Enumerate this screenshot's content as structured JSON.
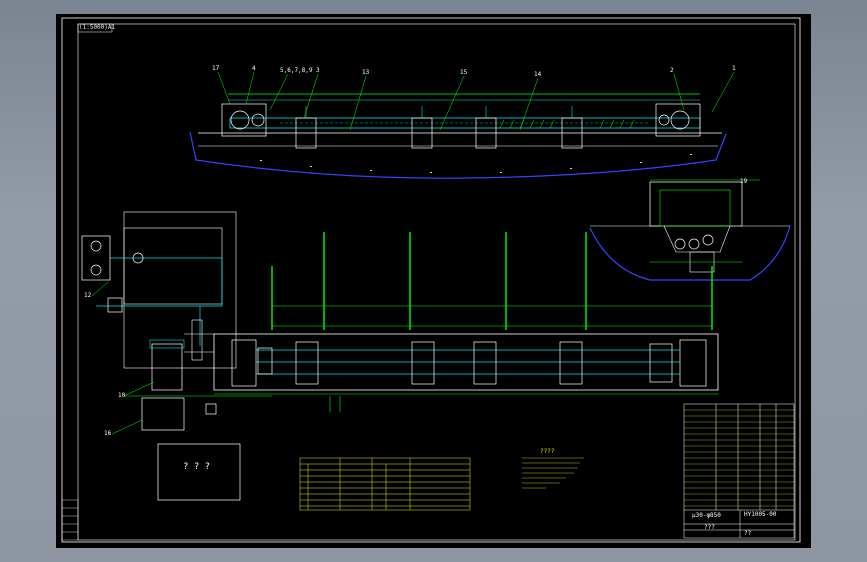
{
  "drawing": {
    "sheet_label": "(1:5000)A1",
    "title_code": "HY1005-00",
    "title_name": "μ30-φ850",
    "placeholder_box": "? ? ?",
    "title_placeholder": "???",
    "bottom_code": "??",
    "notes_title": "????",
    "callouts_top": [
      "17",
      "4",
      "5,6,7,8,9",
      "3",
      "13",
      "15",
      "14",
      "2",
      "1"
    ],
    "callouts_left": [
      "12",
      "10",
      "16"
    ],
    "callout_side": "19"
  },
  "colors": {
    "background": "#000000",
    "frame": "#ffffff",
    "dimension": "#00ff00",
    "structure": "#00e5e5",
    "foundation": "#3344ff",
    "table": "#e8f000",
    "section": "#ffffff"
  }
}
